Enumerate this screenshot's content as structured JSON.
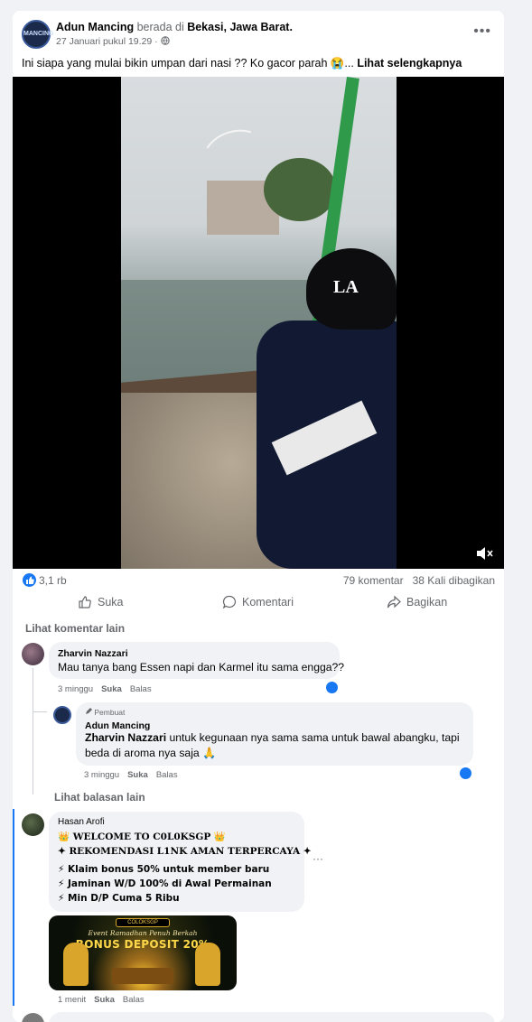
{
  "post": {
    "author": "Adun Mancing",
    "location_prefix": "berada di",
    "location": "Bekasi, Jawa Barat.",
    "timestamp": "27 Januari pukul 19.29 ·",
    "page_logo_text": "MANCING",
    "text": "Ini siapa yang mulai bikin umpan dari nasi ?? Ko gacor parah 😭... ",
    "see_more": "Lihat selengkapnya"
  },
  "stats": {
    "reactions": "3,1 rb",
    "comments": "79 komentar",
    "shares": "38 Kali dibagikan"
  },
  "actions": {
    "like": "Suka",
    "comment": "Komentari",
    "share": "Bagikan"
  },
  "comments_section": {
    "more_comments": "Lihat komentar lain",
    "more_replies": "Lihat balasan lain"
  },
  "comments": [
    {
      "name": "Zharvin Nazzari",
      "text": "Mau tanya bang Essen napi dan Karmel itu sama engga??",
      "time": "3 minggu",
      "like": "Suka",
      "reply": "Balas"
    },
    {
      "badge": "Pembuat",
      "name": "Adun Mancing",
      "mention": "Zharvin Nazzari",
      "text_line1": " untuk kegunaan nya sama sama untuk bawal abangku, tapi",
      "text_line2": "beda di aroma nya saja 🙏",
      "time": "3 minggu",
      "like": "Suka",
      "reply": "Balas"
    },
    {
      "name": "Hasan Arofi",
      "line1": "👑 WELCOME TO C0L0KSGP 👑",
      "line2": "✦ REKOMENDASI L1NK AMAN TERPERCAYA ✦",
      "line3": "⚡ Klaim bonus 50% untuk member baru",
      "line4": "⚡ Jaminan W/D 100% di Awal Permainan",
      "line5": "⚡ Min D/P Cuma 5 Ribu",
      "banner_brand": "COLOKSGP",
      "banner_event": "Event Ramadhan Penuh Berkah",
      "banner_title": "BONUS DEPOSIT 20%",
      "time": "1 menit",
      "like": "Suka",
      "reply": "Balas",
      "options": "···"
    }
  ],
  "colors": {
    "facebook_blue": "#1877f2",
    "muted_text": "#65676b",
    "bubble_bg": "#f0f2f5"
  }
}
